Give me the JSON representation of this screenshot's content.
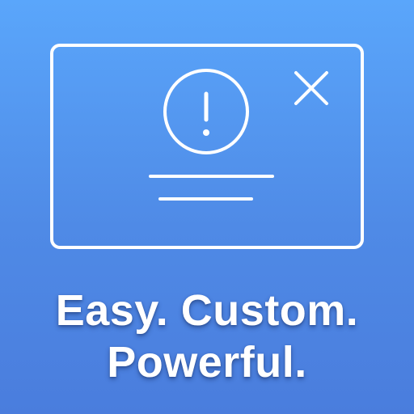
{
  "colors": {
    "background_top": "#5aa6fb",
    "background_bottom": "#4a7ddd",
    "stroke": "#ffffff",
    "text": "#ffffff"
  },
  "illustration": {
    "icons": [
      "dialog-window-icon",
      "close-x-icon",
      "alert-exclamation-icon",
      "text-placeholder-lines"
    ]
  },
  "tagline": {
    "line1": "Easy. Custom.",
    "line2": "Powerful."
  }
}
